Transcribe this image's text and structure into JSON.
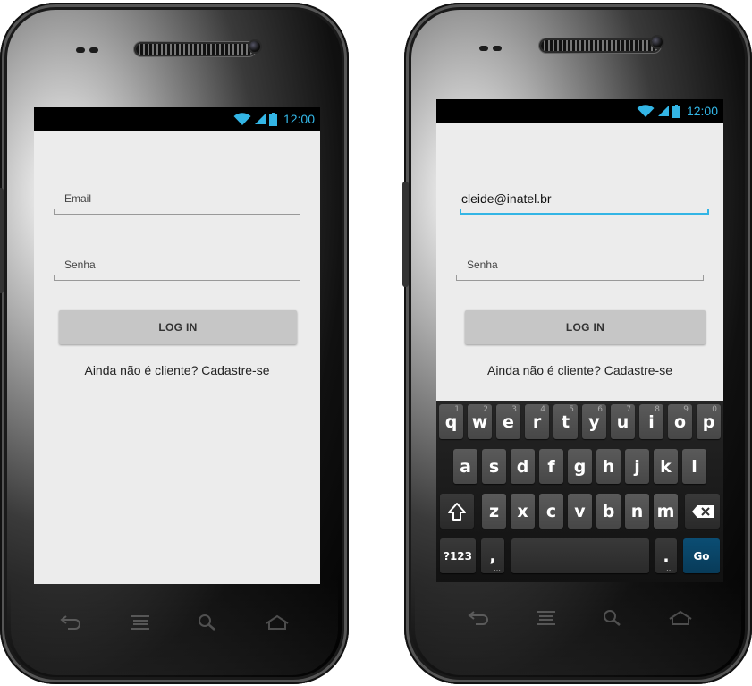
{
  "status_bar": {
    "time": "12:00"
  },
  "colors": {
    "accent": "#33b5e5",
    "screen_bg": "#ececec",
    "button_bg": "#c6c6c6",
    "go_key": "#0b4d73"
  },
  "left_screen": {
    "email_hint": "Email",
    "password_hint": "Senha",
    "login_label": "LOG IN",
    "signup_text": "Ainda não é cliente? Cadastre-se"
  },
  "right_screen": {
    "email_value": "cleide@inatel.br",
    "password_hint": "Senha",
    "login_label": "LOG IN",
    "signup_text": "Ainda não é cliente? Cadastre-se"
  },
  "keyboard": {
    "row1": [
      {
        "key": "q",
        "hint": "1"
      },
      {
        "key": "w",
        "hint": "2"
      },
      {
        "key": "e",
        "hint": "3"
      },
      {
        "key": "r",
        "hint": "4"
      },
      {
        "key": "t",
        "hint": "5"
      },
      {
        "key": "y",
        "hint": "6"
      },
      {
        "key": "u",
        "hint": "7"
      },
      {
        "key": "i",
        "hint": "8"
      },
      {
        "key": "o",
        "hint": "9"
      },
      {
        "key": "p",
        "hint": "0"
      }
    ],
    "row2": [
      "a",
      "s",
      "d",
      "f",
      "g",
      "h",
      "j",
      "k",
      "l"
    ],
    "row3": [
      "z",
      "x",
      "c",
      "v",
      "b",
      "n",
      "m"
    ],
    "symbols_label": "?123",
    "comma": ",",
    "period": ".",
    "go_label": "Go"
  },
  "icons": [
    "wifi-icon",
    "signal-icon",
    "battery-icon",
    "back-icon",
    "menu-icon",
    "search-icon",
    "home-icon",
    "shift-icon",
    "backspace-icon"
  ]
}
